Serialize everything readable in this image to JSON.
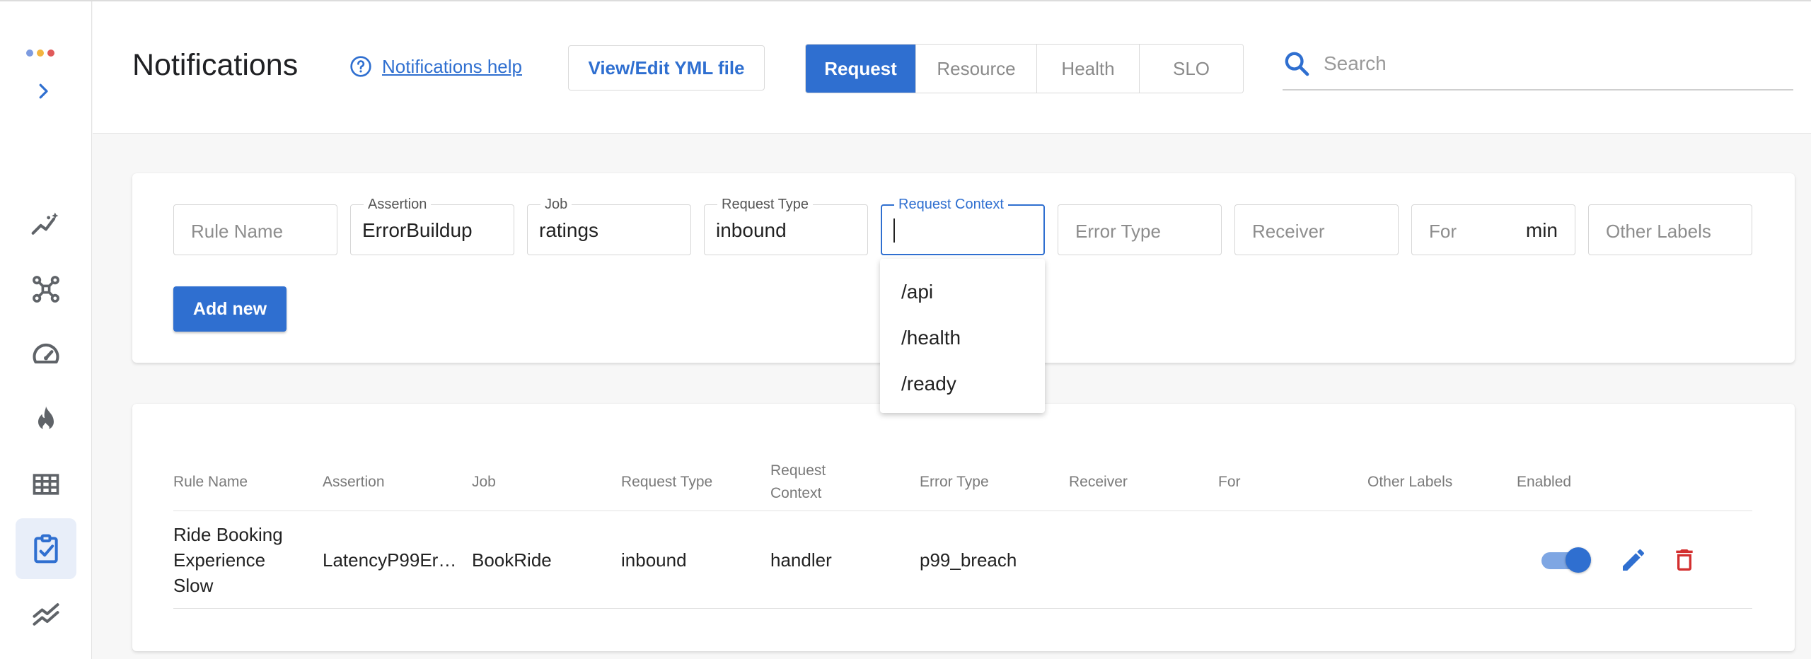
{
  "colors": {
    "accent": "#2f6fd0",
    "danger": "#d32f2f",
    "logo_dots": [
      "#7d9be0",
      "#f2b540",
      "#e05a5a"
    ]
  },
  "sidebar": {
    "items": [
      {
        "name": "insights",
        "icon": "sparkline-icon",
        "active": false
      },
      {
        "name": "topology",
        "icon": "graph-nodes-icon",
        "active": false
      },
      {
        "name": "slo",
        "icon": "speedometer-icon",
        "active": false
      },
      {
        "name": "hotspots",
        "icon": "fire-icon",
        "active": false
      },
      {
        "name": "grid",
        "icon": "grid-icon",
        "active": false
      },
      {
        "name": "notifications",
        "icon": "clipboard-check-icon",
        "active": true
      },
      {
        "name": "trends",
        "icon": "trend-lines-icon",
        "active": false
      }
    ]
  },
  "header": {
    "title": "Notifications",
    "help_link": "Notifications help",
    "yml_button": "View/Edit YML file",
    "tabs": [
      {
        "label": "Request",
        "active": true
      },
      {
        "label": "Resource",
        "active": false
      },
      {
        "label": "Health",
        "active": false
      },
      {
        "label": "SLO",
        "active": false
      }
    ],
    "search_placeholder": "Search"
  },
  "form": {
    "rule_name_placeholder": "Rule Name",
    "assertion_label": "Assertion",
    "assertion_value": "ErrorBuildup",
    "job_label": "Job",
    "job_value": "ratings",
    "request_type_label": "Request Type",
    "request_type_value": "inbound",
    "request_context_label": "Request Context",
    "request_context_value": "",
    "error_type_placeholder": "Error Type",
    "receiver_placeholder": "Receiver",
    "for_placeholder": "For",
    "for_unit": "min",
    "other_labels_placeholder": "Other Labels",
    "add_button": "Add new",
    "context_options": [
      "/api",
      "/health",
      "/ready"
    ]
  },
  "table": {
    "headers": [
      "Rule Name",
      "Assertion",
      "Job",
      "Request Type",
      "Request Context",
      "Error Type",
      "Receiver",
      "For",
      "Other Labels",
      "Enabled"
    ],
    "rows": [
      {
        "rule_name": "Ride Booking Experience Slow",
        "assertion": "LatencyP99Er…",
        "job": "BookRide",
        "request_type": "inbound",
        "request_context": "handler",
        "error_type": "p99_breach",
        "receiver": "",
        "for": "",
        "other_labels": "",
        "enabled": true
      }
    ]
  }
}
